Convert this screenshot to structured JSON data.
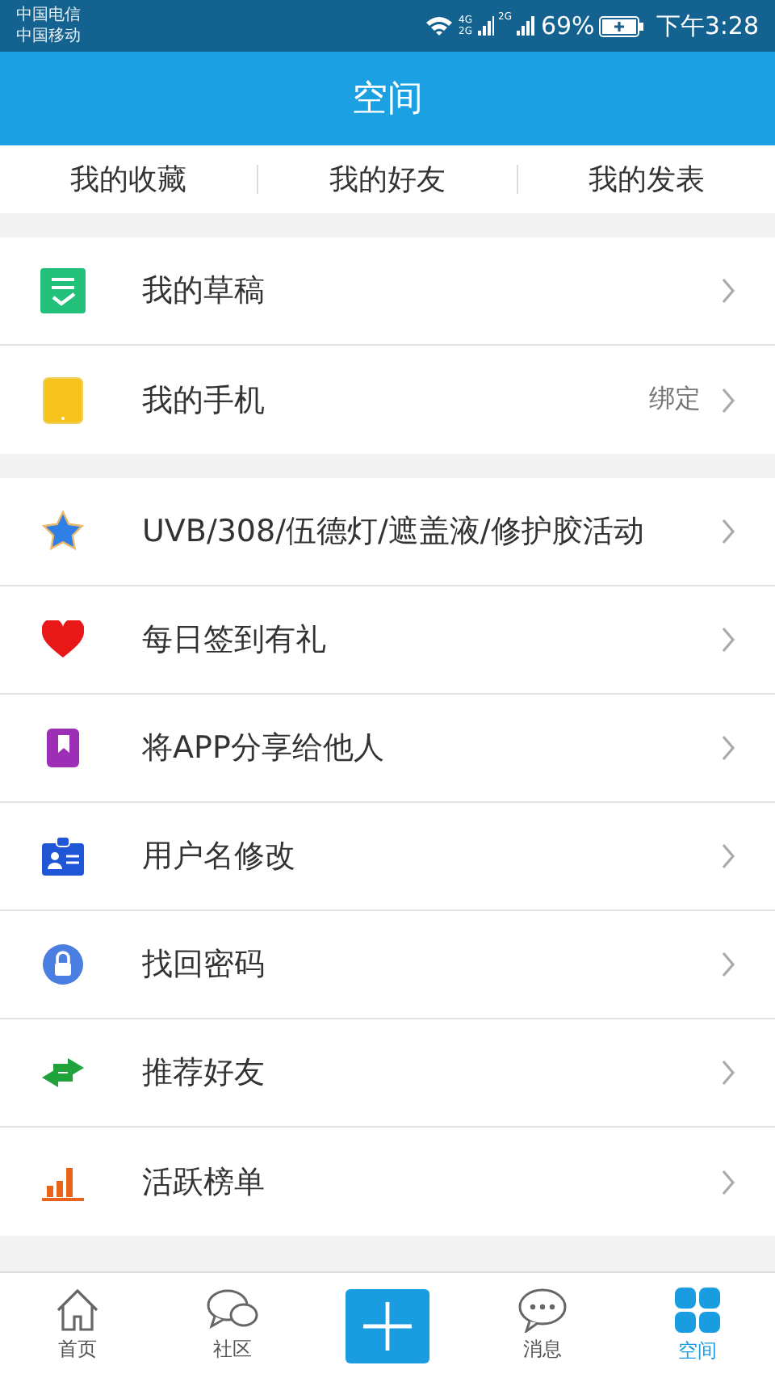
{
  "status_bar": {
    "carriers": [
      "中国电信",
      "中国移动"
    ],
    "network_labels": [
      "4G",
      "2G",
      "2G"
    ],
    "battery": "69%",
    "time": "下午3:28"
  },
  "header": {
    "title": "空间"
  },
  "tabs": [
    {
      "label": "我的收藏"
    },
    {
      "label": "我的好友"
    },
    {
      "label": "我的发表"
    }
  ],
  "sections": [
    {
      "rows": [
        {
          "label": "我的草稿"
        },
        {
          "label": "我的手机",
          "value": "绑定"
        }
      ]
    },
    {
      "rows": [
        {
          "label": "UVB/308/伍德灯/遮盖液/修护胶活动"
        },
        {
          "label": "每日签到有礼"
        },
        {
          "label": "将APP分享给他人"
        },
        {
          "label": "用户名修改"
        },
        {
          "label": "找回密码"
        },
        {
          "label": "推荐好友"
        },
        {
          "label": "活跃榜单"
        }
      ]
    }
  ],
  "bottom_nav": [
    {
      "kind": "tab",
      "label": "首页",
      "selected": false
    },
    {
      "kind": "tab",
      "label": "社区",
      "selected": false
    },
    {
      "kind": "add"
    },
    {
      "kind": "tab",
      "label": "消息",
      "selected": false
    },
    {
      "kind": "tab",
      "label": "空间",
      "selected": true
    }
  ]
}
